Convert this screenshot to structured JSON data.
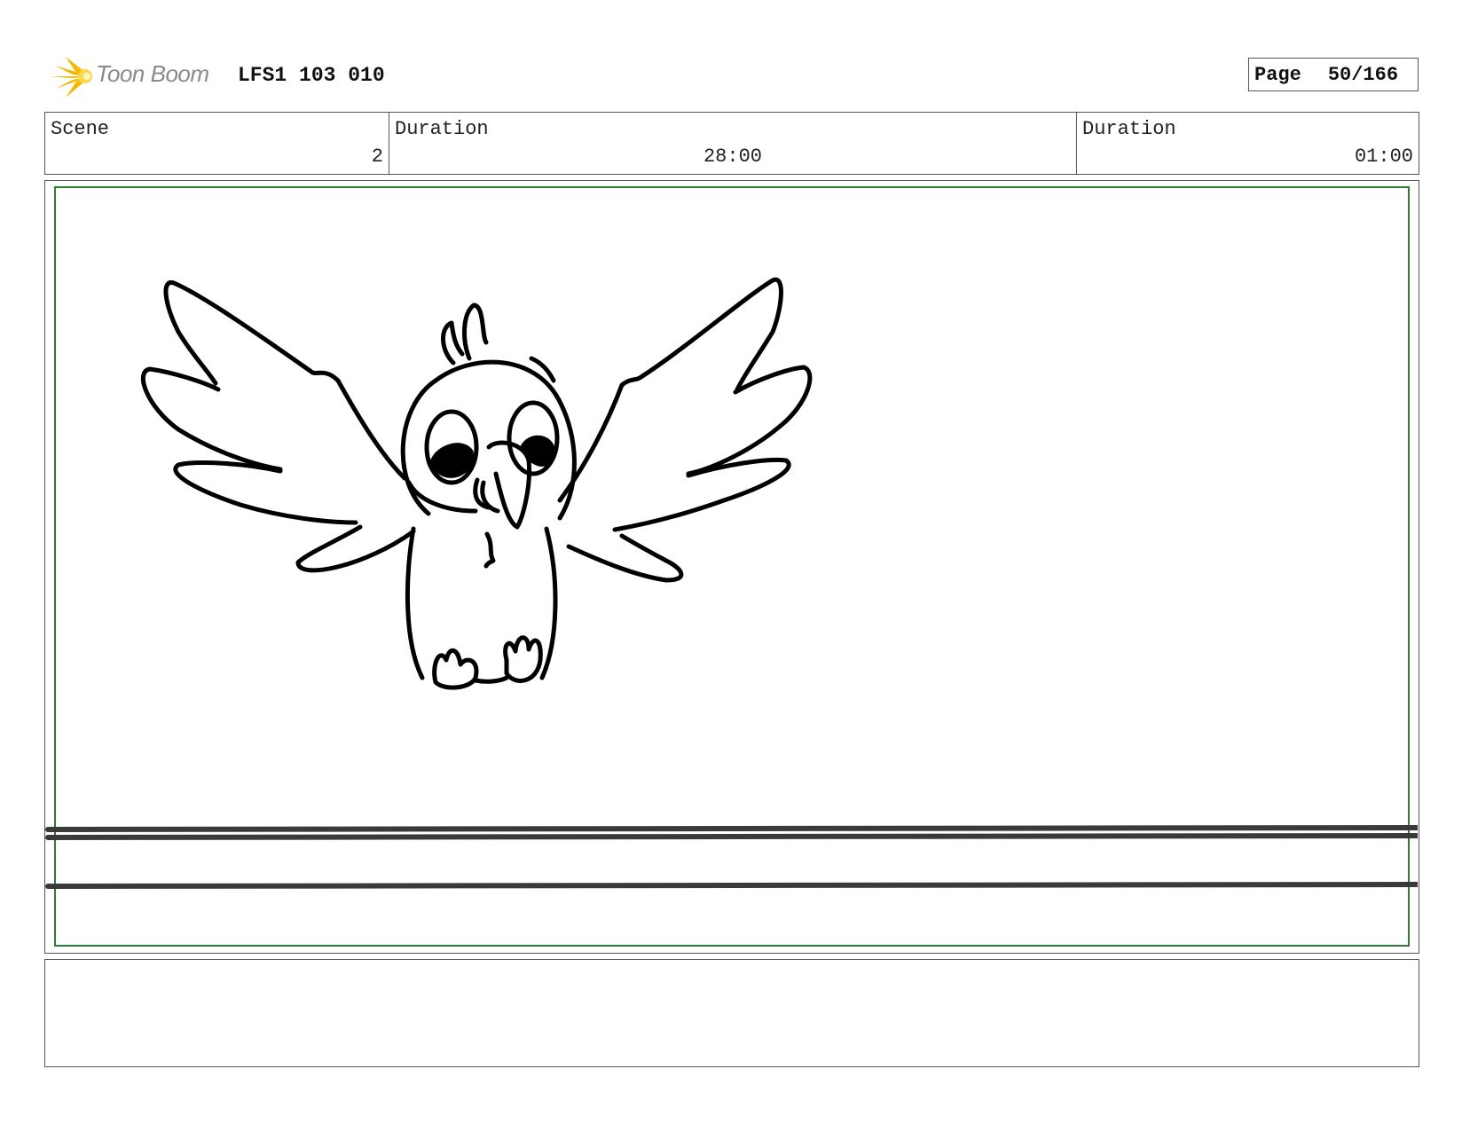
{
  "header": {
    "logo_text": "Toon Boom",
    "doc_id": "LFS1 103 010",
    "page_label": "Page",
    "page_number": "50/166"
  },
  "info": {
    "scene_label": "Scene",
    "scene_value": "2",
    "duration1_label": "Duration",
    "duration1_value": "28:00",
    "duration2_label": "Duration",
    "duration2_value": "01:00"
  },
  "panel": {
    "frame_color": "#2e7d32",
    "sketch": "bird-character-sketch"
  },
  "notes": {
    "text": ""
  }
}
